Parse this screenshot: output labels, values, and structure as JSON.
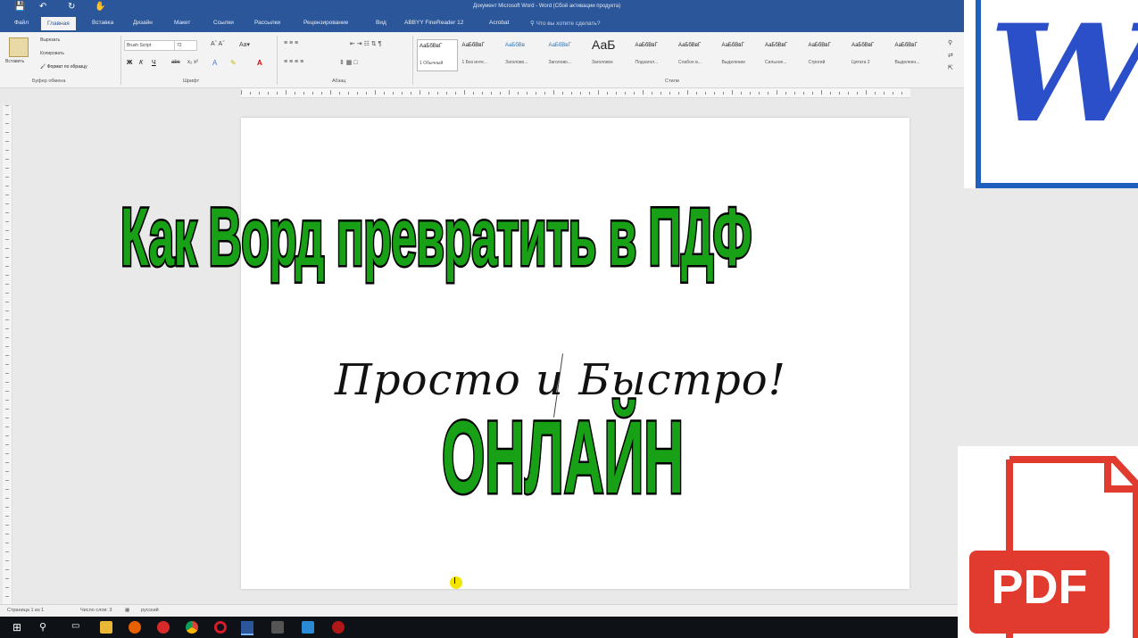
{
  "titlebar": {
    "title": "Документ Microsoft Word - Word (Сбой активации продукта)",
    "save_icon": "save-icon",
    "undo_icon": "undo-icon",
    "redo_icon": "redo-icon",
    "touch_icon": "touch-mode-icon"
  },
  "tabs": [
    {
      "label": "Файл"
    },
    {
      "label": "Главная"
    },
    {
      "label": "Вставка"
    },
    {
      "label": "Дизайн"
    },
    {
      "label": "Макет"
    },
    {
      "label": "Ссылки"
    },
    {
      "label": "Рассылки"
    },
    {
      "label": "Рецензирование"
    },
    {
      "label": "Вид"
    },
    {
      "label": "ABBYY FineReader 12"
    },
    {
      "label": "Acrobat"
    }
  ],
  "search_hint": "Что вы хотите сделать?",
  "clipboard": {
    "paste_label": "Вставить",
    "cut_label": "Вырезать",
    "copy_label": "Копировать",
    "format_painter_label": "Формат по образцу",
    "group_label": "Буфер обмена"
  },
  "font": {
    "font_name": "Brush Script",
    "font_size": "72",
    "group_label": "Шрифт"
  },
  "paragraph": {
    "group_label": "Абзац"
  },
  "styles": {
    "group_label": "Стили",
    "items": [
      {
        "preview": "АаБбВвГ",
        "name": "1 Обычный"
      },
      {
        "preview": "АаБбВвГ",
        "name": "1 Без инте..."
      },
      {
        "preview": "АаБбВв",
        "name": "Заголово..."
      },
      {
        "preview": "АаБбВвГ",
        "name": "Заголово..."
      },
      {
        "preview": "АаБ",
        "name": "Заголовок"
      },
      {
        "preview": "АаБбВвГ",
        "name": "Подзагол..."
      },
      {
        "preview": "АаБбВвГ",
        "name": "Слабое в..."
      },
      {
        "preview": "АаБбВвГ",
        "name": "Выделение"
      },
      {
        "preview": "АаБбВвГ",
        "name": "Сильное..."
      },
      {
        "preview": "АаБбВвГ",
        "name": "Строгий"
      },
      {
        "preview": "АаБбВвГ",
        "name": "Цитата 2"
      },
      {
        "preview": "АаБбВвГ",
        "name": "Выделенн..."
      }
    ]
  },
  "statusbar": {
    "page": "Страница 1 из 1",
    "words": "Число слов: 3",
    "language": "русский"
  },
  "overlay": {
    "headline": "Как Ворд превратить в ПДФ",
    "subtitle": "Просто и Быстро!",
    "online": "ОНЛАЙН"
  },
  "word_logo": {
    "letter": "W"
  },
  "pdf_logo": {
    "label": "PDF"
  },
  "taskbar_icons": [
    "windows-start-icon",
    "search-icon",
    "task-view-icon",
    "file-explorer-icon",
    "firefox-icon",
    "yandex-icon",
    "chrome-icon",
    "opera-icon",
    "word-taskbar-icon",
    "media-icon",
    "edge-icon",
    "record-icon"
  ],
  "colors": {
    "word_blue": "#2b579a",
    "headline_green": "#18a116",
    "pdf_red": "#e13b2f"
  }
}
